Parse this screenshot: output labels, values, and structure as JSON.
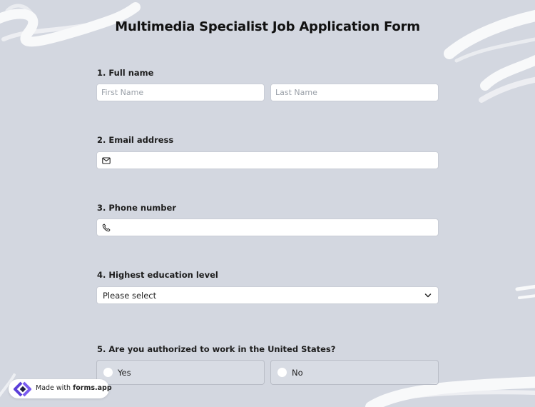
{
  "form": {
    "title": "Multimedia Specialist Job Application Form"
  },
  "questions": {
    "q1": {
      "label": "1.  Full name",
      "first_placeholder": "First Name",
      "last_placeholder": "Last Name"
    },
    "q2": {
      "label": "2. Email address",
      "icon": "envelope-icon"
    },
    "q3": {
      "label": "3. Phone number",
      "icon": "phone-icon"
    },
    "q4": {
      "label": "4. Highest education level",
      "selected": "Please select"
    },
    "q5": {
      "label": "5. Are you authorized to work in the United States?",
      "options": [
        "Yes",
        "No"
      ]
    }
  },
  "badge": {
    "prefix": "Made with",
    "brand": "forms.app"
  },
  "colors": {
    "background": "#d3d7e0",
    "field": "#ffffff",
    "brand_logo": "#5b3fd9"
  }
}
